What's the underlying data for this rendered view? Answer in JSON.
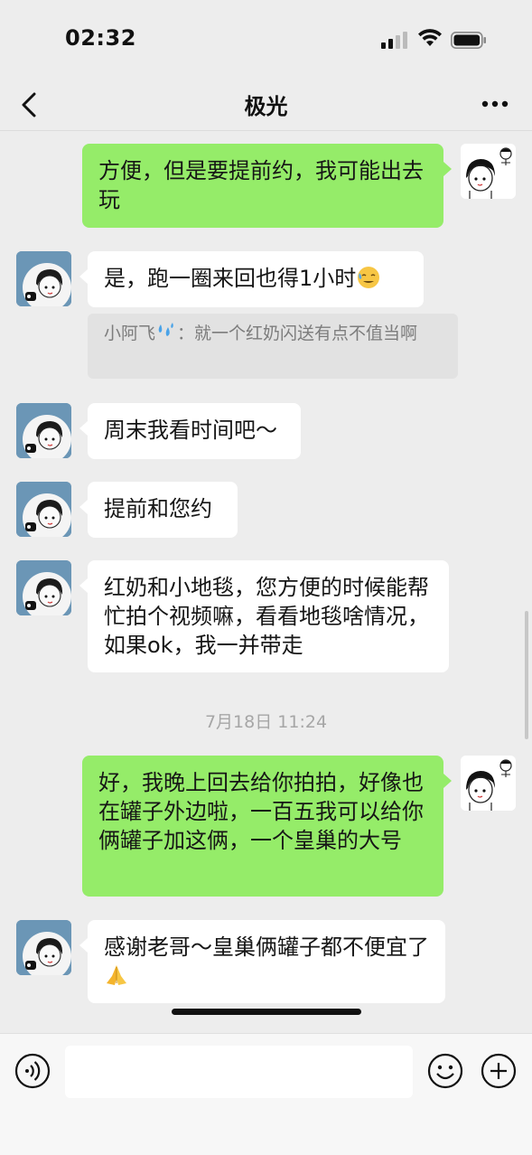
{
  "status_bar": {
    "time": "02:32"
  },
  "nav": {
    "title": "极光"
  },
  "messages": [
    {
      "side": "right",
      "text": "方便，但是要提前约，我可能出去玩"
    },
    {
      "side": "left",
      "text": "是，跑一圈来回也得1小时"
    },
    {
      "side": "left",
      "text": "周末我看时间吧～"
    },
    {
      "side": "left",
      "text": "提前和您约"
    },
    {
      "side": "left",
      "text": "红奶和小地毯，您方便的时候能帮忙拍个视频嘛，看看地毯啥情况，如果ok，我一并带走"
    },
    {
      "side": "right",
      "text": "好，我晚上回去给你拍拍，好像也在罐子外边啦，一百五我可以给你俩罐子加这俩，一个皇巢的大号"
    },
    {
      "side": "left",
      "text": "感谢老哥～皇巢俩罐子都不便宜了"
    }
  ],
  "quote": {
    "sender": "小阿飞",
    "text": "：就一个红奶闪送有点不值当啊"
  },
  "timestamp": "7月18日 11:24",
  "input": {
    "placeholder": ""
  },
  "colors": {
    "self_bubble": "#95ec69",
    "other_bubble": "#ffffff",
    "background": "#ededed"
  },
  "icons": [
    "back-icon",
    "more-icon",
    "voice-icon",
    "emoji-icon",
    "plus-icon",
    "sweat-emoji",
    "splash-emoji",
    "pray-emoji"
  ]
}
